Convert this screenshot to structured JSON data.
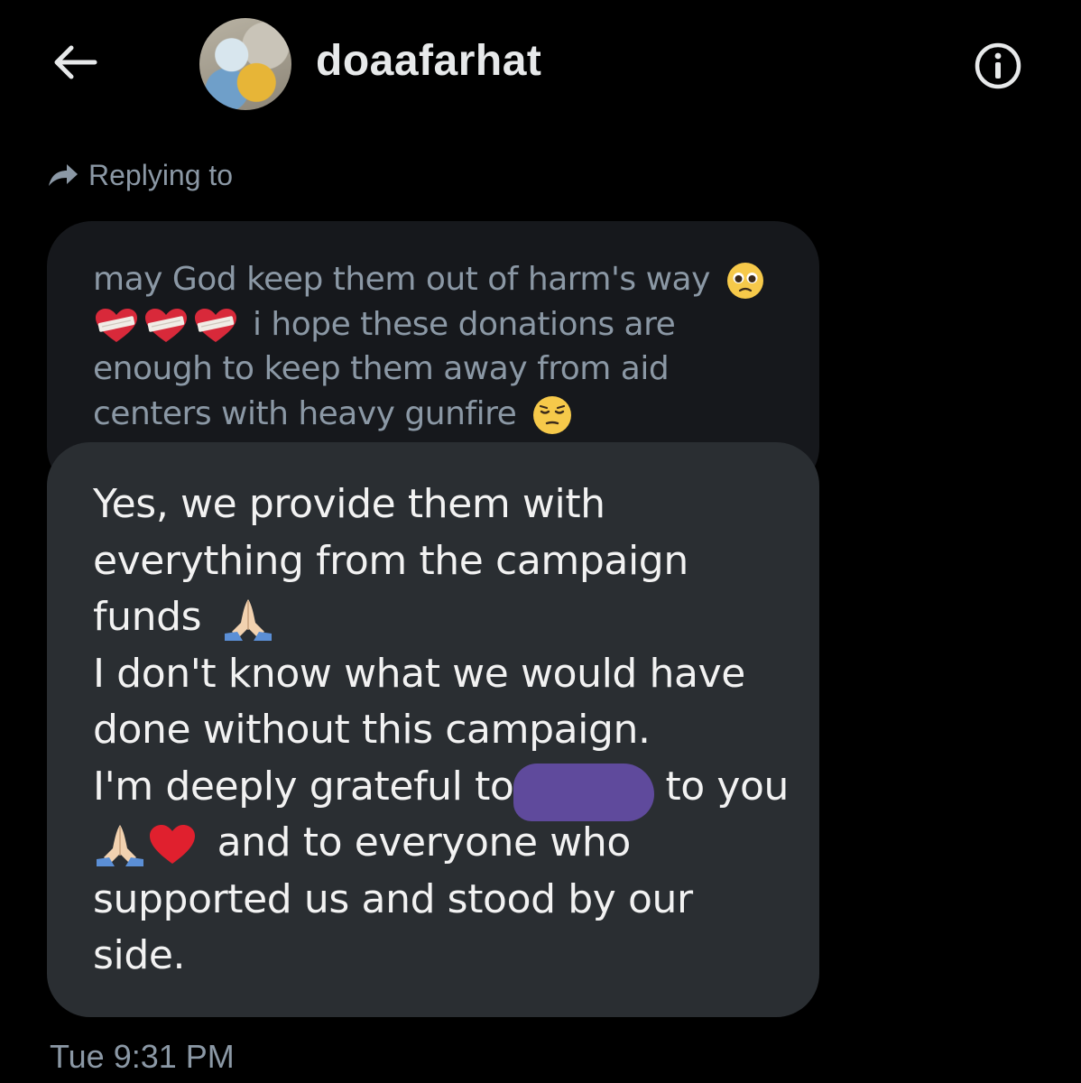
{
  "header": {
    "username": "doaafarhat",
    "back_icon": "arrow-left-icon",
    "info_icon": "info-icon"
  },
  "reply": {
    "label": "Replying to",
    "icon": "reply-arrow-icon"
  },
  "quoted_message": {
    "line1": "may God keep them out of harm's way",
    "line2": "i hope these donations are",
    "line3": "enough to keep them away from aid",
    "line4": "centers with heavy gunfire",
    "emojis": [
      "pleading-face",
      "mending-heart",
      "pensive-face"
    ]
  },
  "message": {
    "line1": "Yes, we provide them with",
    "line2": "everything from the campaign",
    "line3": "funds",
    "line4": "I don't know what we would have",
    "line5": "done without this campaign.",
    "line6a": "I'm deeply grateful to",
    "line6b": "to you",
    "line7": "and to everyone who",
    "line8": "supported us and stood by our",
    "line9": "side.",
    "emojis": [
      "folded-hands",
      "red-heart"
    ],
    "redaction_color": "#5f4a9c"
  },
  "timestamp": "Tue 9:31 PM",
  "colors": {
    "background": "#000000",
    "quoted_bubble": "#16181c",
    "message_bubble": "#2a2e32",
    "secondary_text": "#8b98a5",
    "primary_text": "#e7e9ea"
  }
}
